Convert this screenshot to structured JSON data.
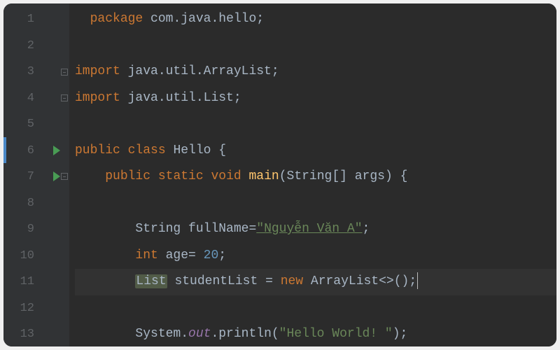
{
  "gutter": {
    "numbers": [
      "1",
      "2",
      "3",
      "4",
      "5",
      "6",
      "7",
      "8",
      "9",
      "10",
      "11",
      "12",
      "13"
    ]
  },
  "code": {
    "l1": {
      "kw1": "package",
      "pkg": "com.java.hello",
      "semi": ";"
    },
    "l3": {
      "kw1": "import",
      "pkg": "java.util.ArrayList",
      "semi": ";"
    },
    "l4": {
      "kw1": "import",
      "pkg": "java.util.List",
      "semi": ";"
    },
    "l6": {
      "kw1": "public",
      "kw2": "class",
      "name": "Hello",
      "brace": "{"
    },
    "l7": {
      "kw1": "public",
      "kw2": "static",
      "kw3": "void",
      "fname": "main",
      "open": "(",
      "type": "String",
      "brackets": "[]",
      "param": " args",
      "close": ")",
      "brace": " {"
    },
    "l9": {
      "type": "String",
      "var": " fullName",
      "eq": "=",
      "str": "\"Nguyễn Văn A\"",
      "semi": ";"
    },
    "l10": {
      "type": "int",
      "var": " age",
      "eq": "= ",
      "num": "20",
      "semi": ";"
    },
    "l11": {
      "type": "List",
      "var": " studentList ",
      "eq": "= ",
      "kw": "new",
      "cls": " ArrayList<>()",
      "semi": ";"
    },
    "l13": {
      "cls": "System.",
      "field": "out",
      "method": ".println(",
      "str": "\"Hello World! \"",
      "close": ");"
    }
  },
  "icons": {
    "run": "run",
    "fold": "fold"
  }
}
